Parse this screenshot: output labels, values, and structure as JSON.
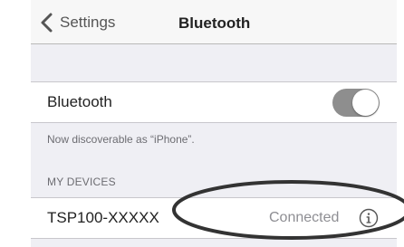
{
  "navbar": {
    "back_label": "Settings",
    "title": "Bluetooth",
    "back_icon": "chevron-left-icon"
  },
  "bluetooth_cell": {
    "label": "Bluetooth",
    "toggle_on": true,
    "toggle_color": "#8e8e8e"
  },
  "discoverable_text": "Now discoverable as “iPhone”.",
  "my_devices": {
    "header": "MY DEVICES",
    "items": [
      {
        "name": "TSP100-XXXXX",
        "status": "Connected",
        "accessory_icon": "info-icon"
      }
    ]
  },
  "annotation": {
    "icon": "highlight-ellipse",
    "color": "#333333"
  }
}
